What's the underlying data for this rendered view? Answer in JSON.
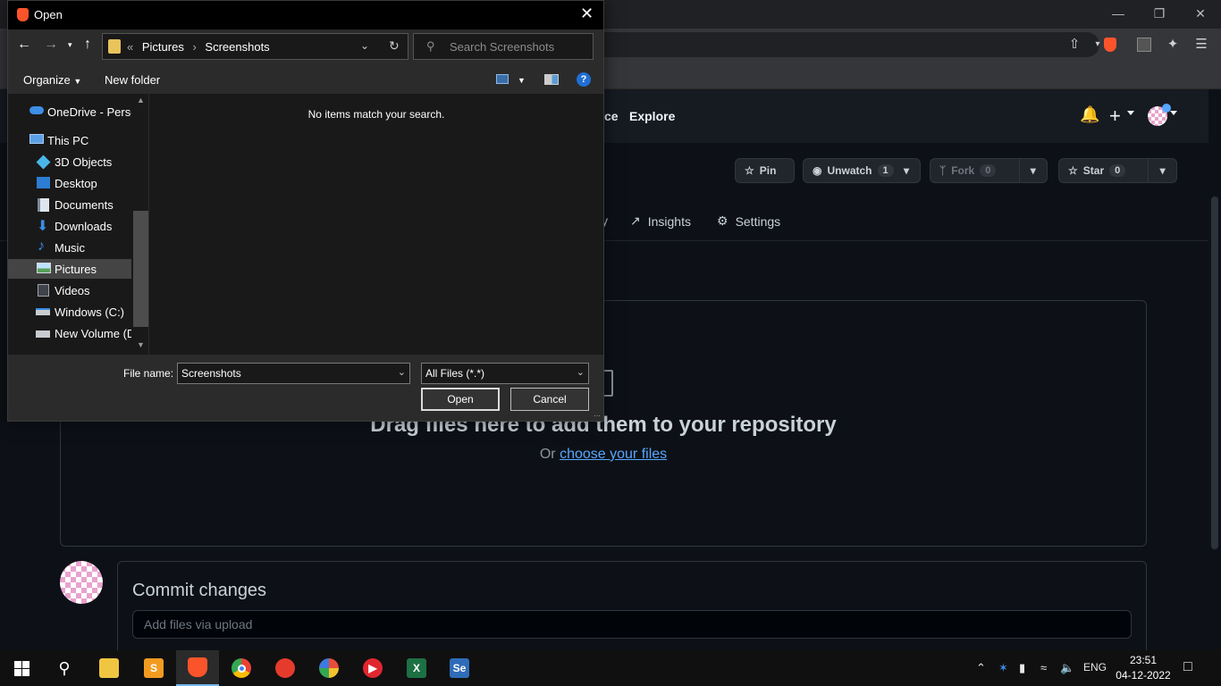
{
  "dialog": {
    "title": "Open",
    "breadcrumb": [
      "Pictures",
      "Screenshots"
    ],
    "breadcrumb_prefix": "«",
    "search_placeholder": "Search Screenshots",
    "organize_label": "Organize",
    "new_folder_label": "New folder",
    "empty_message": "No items match your search.",
    "nav_items": [
      {
        "label": "OneDrive - Persor",
        "icon": "onedrive-icon"
      },
      {
        "label": "This PC",
        "icon": "pc-icon"
      },
      {
        "label": "3D Objects",
        "icon": "cube-icon"
      },
      {
        "label": "Desktop",
        "icon": "desktop-icon"
      },
      {
        "label": "Documents",
        "icon": "documents-icon"
      },
      {
        "label": "Downloads",
        "icon": "download-icon"
      },
      {
        "label": "Music",
        "icon": "music-icon"
      },
      {
        "label": "Pictures",
        "icon": "pictures-icon",
        "selected": true
      },
      {
        "label": "Videos",
        "icon": "videos-icon"
      },
      {
        "label": "Windows (C:)",
        "icon": "drive-icon"
      },
      {
        "label": "New Volume (D:",
        "icon": "drive-icon"
      }
    ],
    "file_name_label": "File name:",
    "file_name_value": "Screenshots",
    "file_type_value": "All Files (*.*)",
    "open_label": "Open",
    "cancel_label": "Cancel"
  },
  "github": {
    "nav_partial": "ce",
    "nav_explore": "Explore",
    "pin_label": "Pin",
    "unwatch_label": "Unwatch",
    "unwatch_count": "1",
    "fork_label": "Fork",
    "fork_count": "0",
    "star_label": "Star",
    "star_count": "0",
    "tab_partial": "y",
    "tab_insights": "Insights",
    "tab_settings": "Settings",
    "drop_title": "Drag files here to add them to your repository",
    "drop_or": "Or",
    "drop_link": "choose your files",
    "commit_title": "Commit changes",
    "commit_placeholder": "Add files via upload"
  },
  "taskbar": {
    "lang": "ENG",
    "time": "23:51",
    "date": "04-12-2022",
    "excel_glyph": "X",
    "se_glyph": "Se"
  },
  "colors": {
    "accent": "#58a6ff",
    "brave": "#fb542b",
    "gh_bg": "#0d1117"
  }
}
